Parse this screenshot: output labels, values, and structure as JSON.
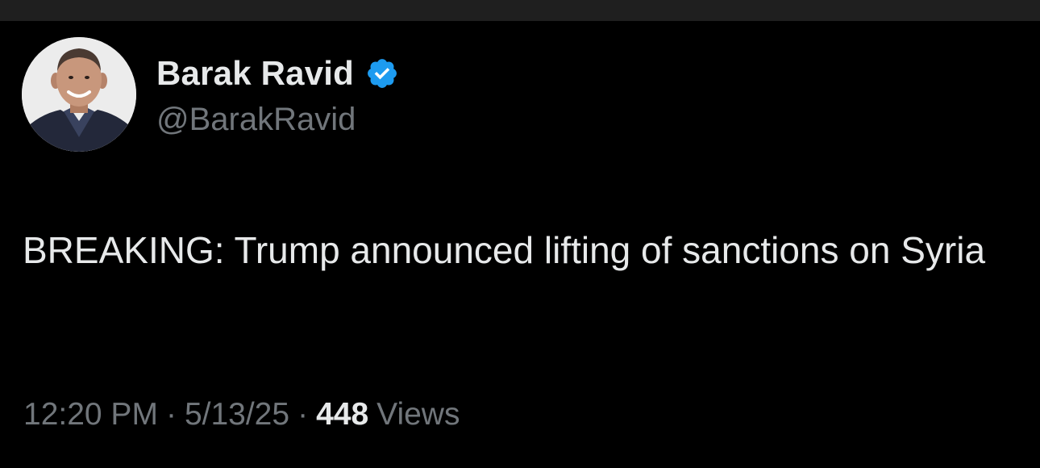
{
  "author": {
    "display_name": "Barak Ravid",
    "handle": "@BarakRavid",
    "verified_icon": "verified-badge-icon",
    "verified_color": "#1d9bf0"
  },
  "tweet": {
    "text": "BREAKING: Trump announced lifting of sanctions on Syria"
  },
  "meta": {
    "time": "12:20 PM",
    "separator": "·",
    "date": "5/13/25",
    "views_count": "448",
    "views_label": "Views"
  },
  "colors": {
    "background": "#000000",
    "primary_text": "#e7e9ea",
    "secondary_text": "#71767b"
  }
}
